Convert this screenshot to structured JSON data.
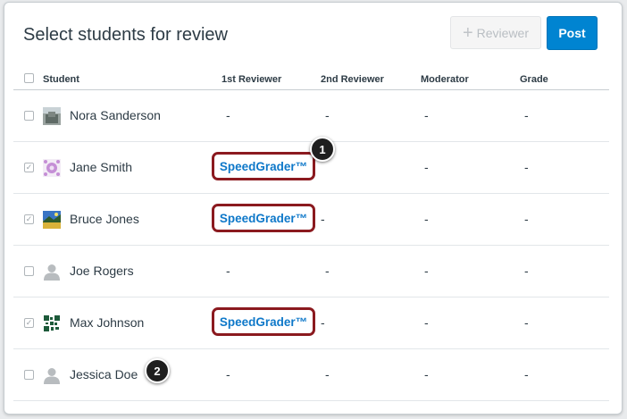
{
  "header": {
    "title": "Select students for review",
    "add_reviewer_label": "Reviewer",
    "post_label": "Post"
  },
  "columns": {
    "student": "Student",
    "first_reviewer": "1st Reviewer",
    "second_reviewer": "2nd Reviewer",
    "moderator": "Moderator",
    "grade": "Grade"
  },
  "rows": [
    {
      "name": "Nora Sanderson",
      "checked": false,
      "avatar": "photo-avatar",
      "first": "-",
      "second": "-",
      "moderator": "-",
      "grade": "-"
    },
    {
      "name": "Jane Smith",
      "checked": true,
      "avatar": "pattern-avatar",
      "first": "SpeedGrader™",
      "second": "",
      "moderator": "-",
      "grade": "-"
    },
    {
      "name": "Bruce Jones",
      "checked": true,
      "avatar": "landscape-avatar",
      "first": "SpeedGrader™",
      "second": "-",
      "moderator": "-",
      "grade": "-"
    },
    {
      "name": "Joe Rogers",
      "checked": false,
      "avatar": "default-person-avatar",
      "first": "-",
      "second": "-",
      "moderator": "-",
      "grade": "-"
    },
    {
      "name": "Max Johnson",
      "checked": true,
      "avatar": "qr-avatar",
      "first": "SpeedGrader™",
      "second": "-",
      "moderator": "-",
      "grade": "-"
    },
    {
      "name": "Jessica Doe",
      "checked": false,
      "avatar": "default-person-avatar",
      "first": "-",
      "second": "-",
      "moderator": "-",
      "grade": "-"
    }
  ],
  "callouts": [
    "1",
    "2"
  ],
  "colors": {
    "accent": "#0084d1",
    "link": "#0e78c9",
    "highlight_border": "#8b1a1f"
  }
}
